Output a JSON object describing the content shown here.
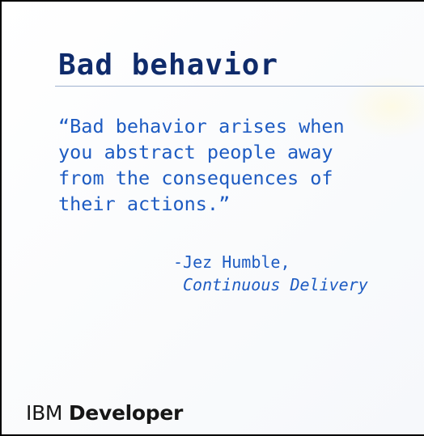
{
  "slide": {
    "title": "Bad behavior",
    "quote": "“Bad behavior arises when\nyou abstract people away\nfrom the consequences of\ntheir actions.”",
    "attribution_author": "-Jez Humble,",
    "attribution_source": "Continuous Delivery"
  },
  "brand": {
    "company": "IBM",
    "product": "Developer"
  },
  "colors": {
    "title": "#0f2b6b",
    "quote": "#1d5bc2",
    "brand": "#161616",
    "background": "#ffffff"
  }
}
